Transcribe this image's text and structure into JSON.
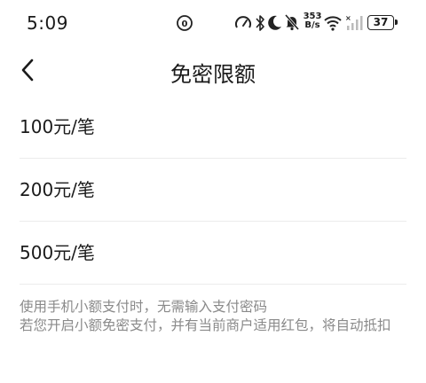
{
  "status_bar": {
    "time": "5:09",
    "net_speed_value": "353",
    "net_speed_unit": "B/s",
    "battery": "37",
    "icons": [
      "notification-icon",
      "data-saver-icon",
      "bluetooth-icon",
      "do-not-disturb-icon",
      "mute-icon",
      "wifi-icon",
      "signal-icon",
      "battery-icon"
    ]
  },
  "header": {
    "back_icon": "back-arrow-icon",
    "title": "免密限额"
  },
  "options": [
    {
      "label": "100元/笔"
    },
    {
      "label": "200元/笔"
    },
    {
      "label": "500元/笔"
    }
  ],
  "footnote": {
    "line1": "使用手机小额支付时，无需输入支付密码",
    "line2": "若您开启小额免密支付，并有当前商户适用红包，将自动抵扣"
  },
  "colors": {
    "background": "#ffffff",
    "text": "#1a1a1a",
    "muted_text": "#8a8a8a",
    "divider": "#ebebeb"
  }
}
